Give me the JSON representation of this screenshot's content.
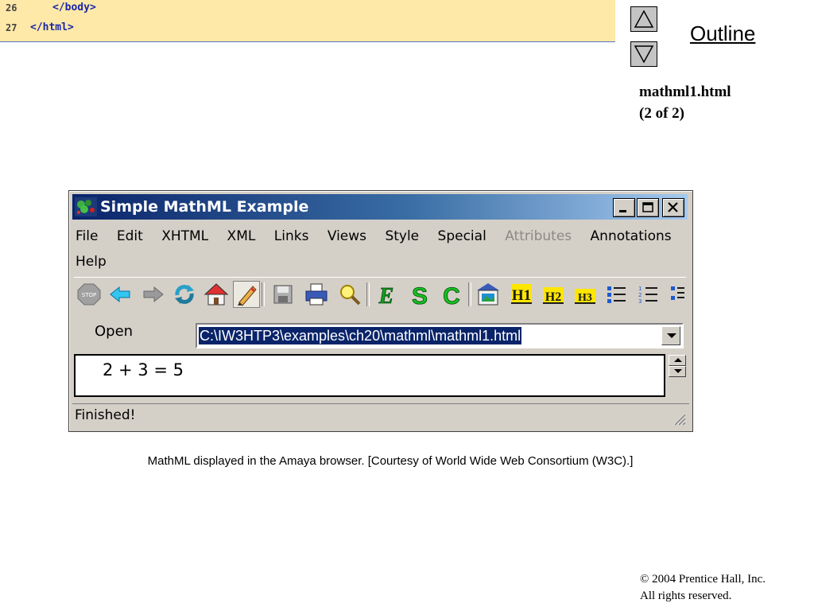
{
  "code": {
    "lines": [
      {
        "num": "26",
        "text": "</body>"
      },
      {
        "num": "27",
        "text": "</html>"
      }
    ],
    "background": "#ffe9a8",
    "text_color": "#1a26a8"
  },
  "nav": {
    "up_icon": "triangle-up-icon",
    "down_icon": "triangle-down-icon",
    "outline_label": "Outline",
    "file_title": "mathml1.html",
    "page_info": "(2 of 2)"
  },
  "window": {
    "title": "Simple MathML Example",
    "title_gradient": [
      "#0a246a",
      "#a6caf0"
    ],
    "caption_buttons": [
      "minimize-icon",
      "maximize-icon",
      "close-icon"
    ],
    "menu_row1": [
      "File",
      "Edit",
      "XHTML",
      "XML",
      "Links",
      "Views",
      "Style",
      "Special",
      "Attributes",
      "Annotations"
    ],
    "menu_row2": [
      "Help"
    ],
    "disabled_menu": "Attributes",
    "toolbar_icons": [
      "stop-icon",
      "back-icon",
      "forward-icon",
      "reload-icon",
      "home-icon",
      "edit-mode-icon",
      "save-icon",
      "print-icon",
      "find-icon",
      "emphasis-icon",
      "strong-icon",
      "code-icon",
      "image-icon",
      "h1-icon",
      "h2-icon",
      "h3-icon",
      "bullet-list-icon",
      "numbered-list-icon",
      "definition-list-icon"
    ],
    "toolbar_labels": {
      "emphasis": "E",
      "strong": "S",
      "code": "C",
      "h1": "H1",
      "h2": "H2",
      "h3": "H3"
    },
    "open_label": "Open",
    "url": "C:\\IW3HTP3\\examples\\ch20\\mathml\\mathml1.html",
    "content": "2 + 3 = 5",
    "status": "Finished!"
  },
  "caption": "MathML displayed in the Amaya browser. [Courtesy of World Wide Web Consortium (W3C).]",
  "copyright": {
    "line1": "© 2004 Prentice Hall, Inc.",
    "line2": "All rights reserved."
  }
}
